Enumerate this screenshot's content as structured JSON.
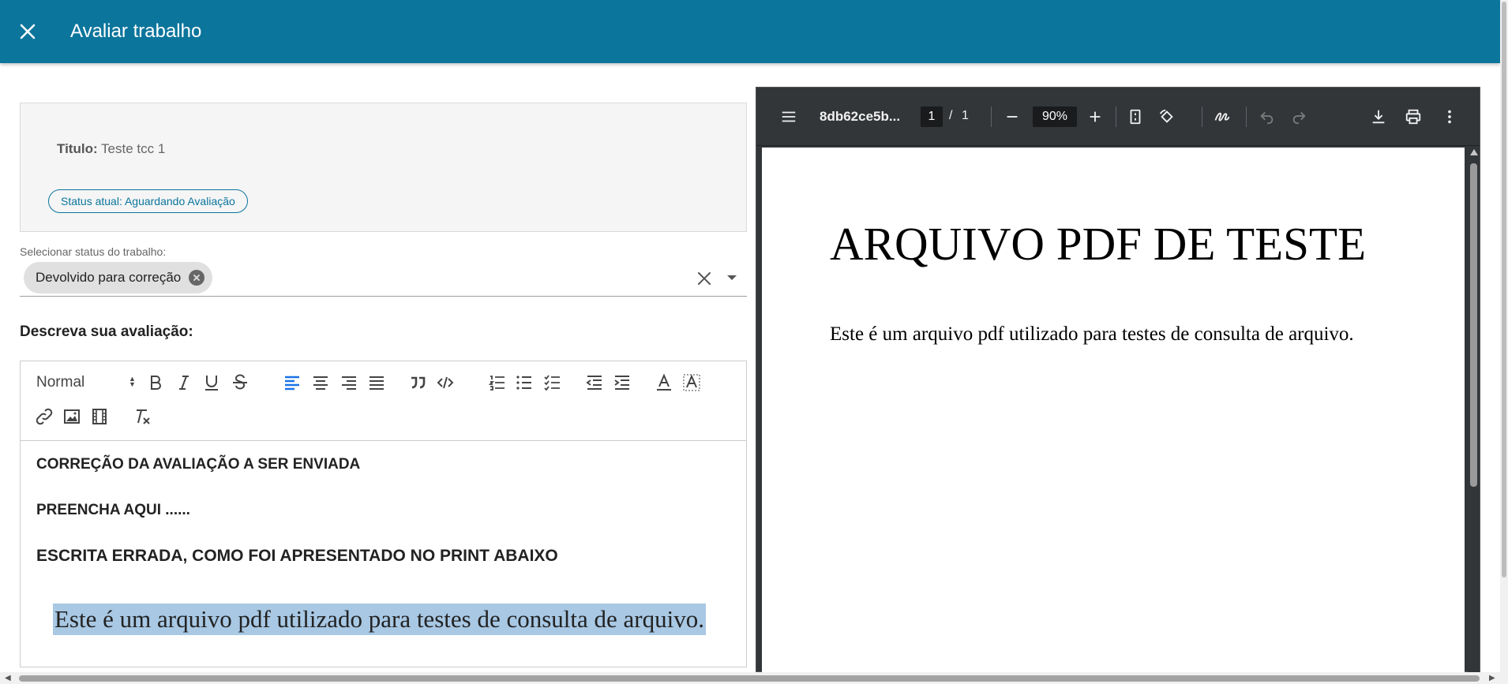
{
  "header": {
    "title": "Avaliar trabalho",
    "close_icon": "close-icon",
    "color": "#0b759c"
  },
  "work_info": {
    "title_label": "Titulo:",
    "title_value": "Teste tcc 1",
    "status_badge": "Status atual: Aguardando Avaliação"
  },
  "status_select": {
    "label": "Selecionar status do trabalho:",
    "selected_chip": "Devolvido para correção"
  },
  "evaluation": {
    "label": "Descreva sua avaliação:",
    "editor": {
      "format_select": "Normal",
      "toolbar_icons": [
        "bold-icon",
        "italic-icon",
        "underline-icon",
        "strike-icon",
        "align-left-icon",
        "align-center-icon",
        "align-right-icon",
        "align-justify-icon",
        "quote-icon",
        "code-icon",
        "ordered-list-icon",
        "bullet-list-icon",
        "check-list-icon",
        "outdent-icon",
        "indent-icon",
        "text-color-icon",
        "background-color-icon",
        "link-icon",
        "image-icon",
        "video-icon",
        "clear-format-icon"
      ],
      "lines": [
        "CORREÇÃO DA AVALIAÇÃO A SER ENVIADA",
        "PREENCHA AQUI  ......",
        "ESCRITA ERRADA, COMO FOI APRESENTADO NO PRINT ABAIXO"
      ],
      "highlighted_quote": "Este é um arquivo pdf utilizado para testes de consulta de arquivo.",
      "highlight_color": "#a8c8e4"
    }
  },
  "pdf_viewer": {
    "file_name": "8db62ce5b...",
    "page_current": "1",
    "page_separator": "/",
    "page_total": "1",
    "zoom": "90%",
    "page_heading": "ARQUIVO PDF DE TESTE",
    "page_body": "Este é um arquivo pdf utilizado para testes de consulta de arquivo."
  }
}
